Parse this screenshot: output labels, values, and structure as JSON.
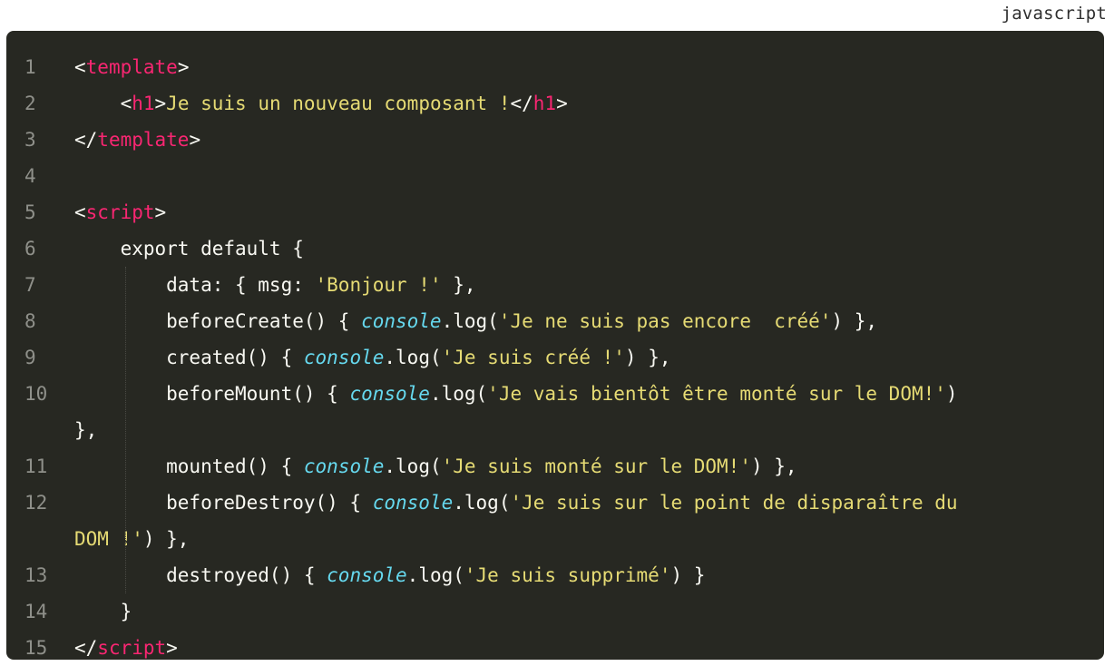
{
  "language": "javascript",
  "lines": [
    {
      "num": "1",
      "tokens": [
        [
          "punc",
          "<"
        ],
        [
          "tag",
          "template"
        ],
        [
          "punc",
          ">"
        ]
      ]
    },
    {
      "num": "2",
      "tokens": [
        [
          "punc",
          "    <"
        ],
        [
          "tag",
          "h1"
        ],
        [
          "punc",
          ">"
        ],
        [
          "str",
          "Je suis un nouveau composant !"
        ],
        [
          "punc",
          "</"
        ],
        [
          "tag",
          "h1"
        ],
        [
          "punc",
          ">"
        ]
      ]
    },
    {
      "num": "3",
      "tokens": [
        [
          "punc",
          "</"
        ],
        [
          "tag",
          "template"
        ],
        [
          "punc",
          ">"
        ]
      ]
    },
    {
      "num": "4",
      "tokens": []
    },
    {
      "num": "5",
      "tokens": [
        [
          "punc",
          "<"
        ],
        [
          "tag",
          "script"
        ],
        [
          "punc",
          ">"
        ]
      ]
    },
    {
      "num": "6",
      "tokens": [
        [
          "txt",
          "    export default {"
        ]
      ]
    },
    {
      "num": "7",
      "tokens": [
        [
          "txt",
          "        data: { msg: "
        ],
        [
          "str",
          "'Bonjour !'"
        ],
        [
          "txt",
          " },"
        ]
      ]
    },
    {
      "num": "8",
      "tokens": [
        [
          "txt",
          "        beforeCreate() { "
        ],
        [
          "obj",
          "console"
        ],
        [
          "txt",
          ".log("
        ],
        [
          "str",
          "'Je ne suis pas encore  créé'"
        ],
        [
          "txt",
          ") },"
        ]
      ]
    },
    {
      "num": "9",
      "tokens": [
        [
          "txt",
          "        created() { "
        ],
        [
          "obj",
          "console"
        ],
        [
          "txt",
          ".log("
        ],
        [
          "str",
          "'Je suis créé !'"
        ],
        [
          "txt",
          ") },"
        ]
      ]
    },
    {
      "num": "10",
      "tokens": [
        [
          "txt",
          "        beforeMount() { "
        ],
        [
          "obj",
          "console"
        ],
        [
          "txt",
          ".log("
        ],
        [
          "str",
          "'Je vais bientôt être monté sur le DOM!'"
        ],
        [
          "txt",
          ")"
        ]
      ]
    },
    {
      "num": "",
      "tokens": [
        [
          "txt",
          "},"
        ]
      ]
    },
    {
      "num": "11",
      "tokens": [
        [
          "txt",
          "        mounted() { "
        ],
        [
          "obj",
          "console"
        ],
        [
          "txt",
          ".log("
        ],
        [
          "str",
          "'Je suis monté sur le DOM!'"
        ],
        [
          "txt",
          ") },"
        ]
      ]
    },
    {
      "num": "12",
      "tokens": [
        [
          "txt",
          "        beforeDestroy() { "
        ],
        [
          "obj",
          "console"
        ],
        [
          "txt",
          ".log("
        ],
        [
          "str",
          "'Je suis sur le point de disparaître du"
        ]
      ]
    },
    {
      "num": "",
      "tokens": [
        [
          "str",
          "DOM !'"
        ],
        [
          "txt",
          ") },"
        ]
      ]
    },
    {
      "num": "13",
      "tokens": [
        [
          "txt",
          "        destroyed() { "
        ],
        [
          "obj",
          "console"
        ],
        [
          "txt",
          ".log("
        ],
        [
          "str",
          "'Je suis supprimé'"
        ],
        [
          "txt",
          ") }"
        ]
      ]
    },
    {
      "num": "14",
      "tokens": [
        [
          "txt",
          "    }"
        ]
      ]
    },
    {
      "num": "15",
      "tokens": [
        [
          "punc",
          "</"
        ],
        [
          "tag",
          "script"
        ],
        [
          "punc",
          ">"
        ]
      ]
    }
  ]
}
